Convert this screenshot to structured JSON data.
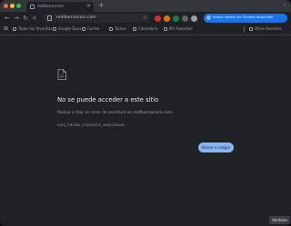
{
  "tab": {
    "title": "redlbarrascom"
  },
  "address_bar": {
    "url": "redlbarrascom.com"
  },
  "banner": {
    "text": "Nueva versión de Chrome disponible"
  },
  "bookmarks": [
    "Todos los favoritos",
    "Google Docs",
    "Correo",
    "Tareas",
    "Calendario",
    "Mis favoritos"
  ],
  "bookmarks_right": "Otros favoritos",
  "error": {
    "title": "No se puede acceder a este sitio",
    "description": "Revisa si hay un error de escritura en redlbarrascom.com.",
    "code": "DNS_PROBE_FINISHED_NXDOMAIN",
    "reload_label": "Volver a cargar"
  },
  "status": "Ventana"
}
